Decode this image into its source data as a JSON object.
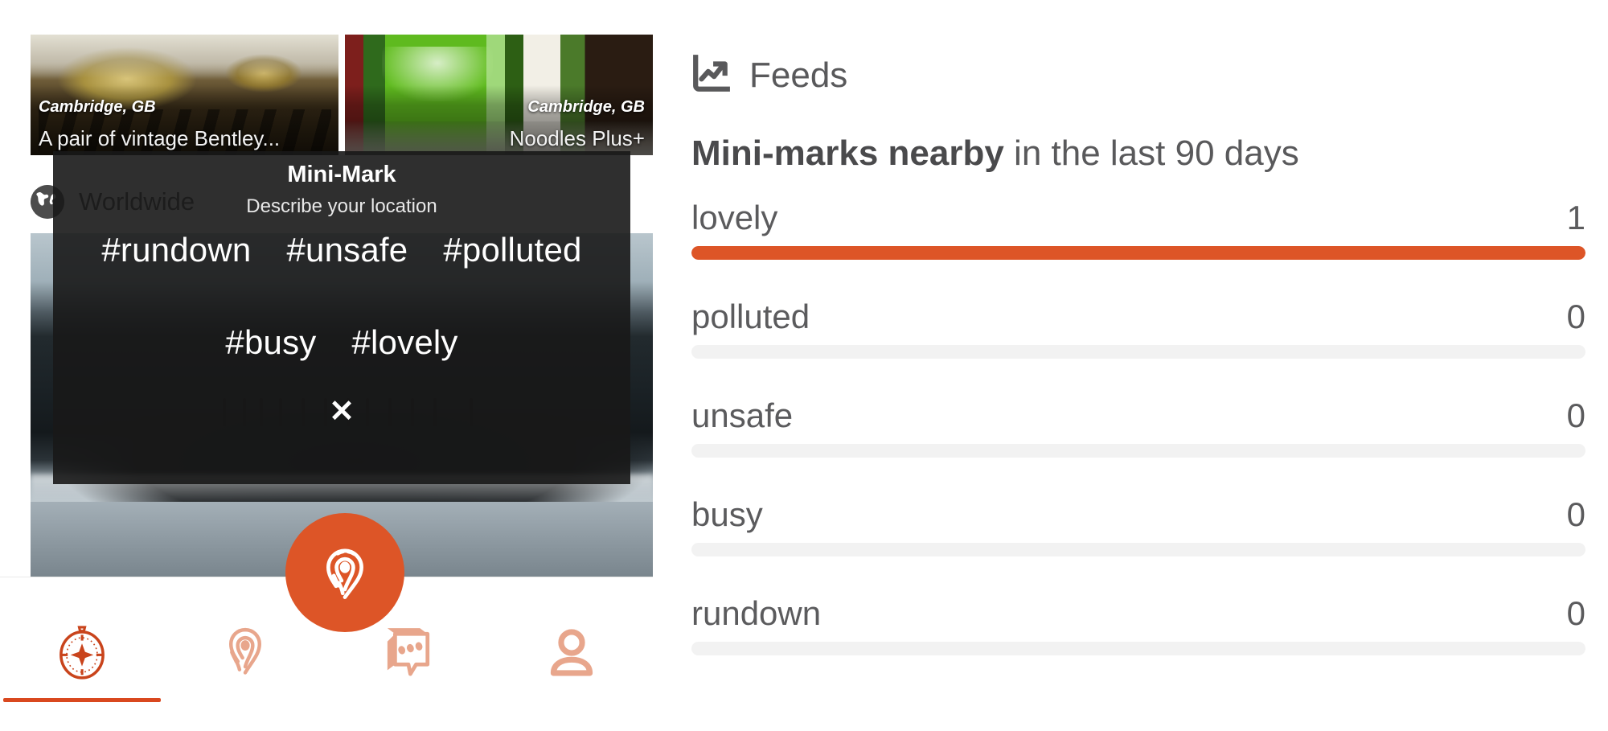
{
  "cards": [
    {
      "location": "Cambridge, GB",
      "title": "A pair of vintage Bentley...",
      "photo": "vintage-cars-photo"
    },
    {
      "location": "Cambridge, GB",
      "title": "Noodles Plus+",
      "photo": "noodle-shop-photo"
    }
  ],
  "scope": {
    "icon": "globe-icon",
    "label": "Worldwide"
  },
  "modal": {
    "title": "Mini-Mark",
    "subtitle": "Describe your location",
    "close_label": "✕",
    "tags_row1": [
      "#rundown",
      "#unsafe",
      "#polluted"
    ],
    "tags_row2": [
      "#busy",
      "#lovely"
    ]
  },
  "fab": {
    "icon": "fingerprint-pin-icon"
  },
  "nav": {
    "items": [
      {
        "icon": "compass-icon",
        "name": "explore",
        "active": true
      },
      {
        "icon": "fingerprint-icon",
        "name": "marks",
        "active": false
      },
      {
        "icon": "chat-bubble-icon",
        "name": "messages",
        "active": false
      },
      {
        "icon": "person-icon",
        "name": "profile",
        "active": false
      }
    ]
  },
  "feeds": {
    "icon": "line-chart-up-icon",
    "title": "Feeds",
    "subtitle_strong": "Mini-marks nearby",
    "subtitle_rest": " in the last 90 days"
  },
  "colors": {
    "accent": "#DD5527",
    "accent_dark": "#D9481F",
    "accent_light": "#E8A68C",
    "track": "#f2f2f2",
    "text": "#59595b",
    "modal_bg": "#181818"
  },
  "chart_data": {
    "type": "bar",
    "title": "Mini-marks nearby in the last 90 days",
    "orientation": "horizontal",
    "categories": [
      "lovely",
      "polluted",
      "unsafe",
      "busy",
      "rundown"
    ],
    "values": [
      1,
      0,
      0,
      0,
      0
    ],
    "xlabel": "",
    "ylabel": "",
    "xlim": [
      0,
      1
    ],
    "grid": false,
    "legend": false,
    "bars": [
      {
        "label": "lovely",
        "value": 1,
        "percent": 100,
        "filled": true
      },
      {
        "label": "polluted",
        "value": 0,
        "percent": 0,
        "filled": false
      },
      {
        "label": "unsafe",
        "value": 0,
        "percent": 0,
        "filled": false
      },
      {
        "label": "busy",
        "value": 0,
        "percent": 0,
        "filled": false
      },
      {
        "label": "rundown",
        "value": 0,
        "percent": 0,
        "filled": false
      }
    ]
  }
}
